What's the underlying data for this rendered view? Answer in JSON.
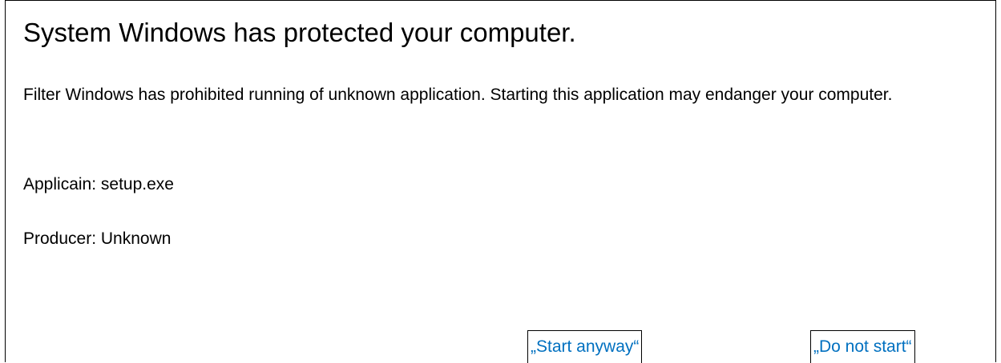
{
  "dialog": {
    "title": "System Windows has protected your computer.",
    "message": "Filter Windows has prohibited running of unknown application. Starting this application may endanger your computer.",
    "application_label": "Applicain",
    "application_value": "setup.exe",
    "producer_label": "Producer",
    "producer_value": "Unknown"
  },
  "actions": {
    "start_anyway": "„Start anyway“",
    "do_not_start": "„Do not start“"
  },
  "colors": {
    "link": "#0070c0",
    "text": "#000000",
    "border": "#000000",
    "background": "#ffffff"
  }
}
